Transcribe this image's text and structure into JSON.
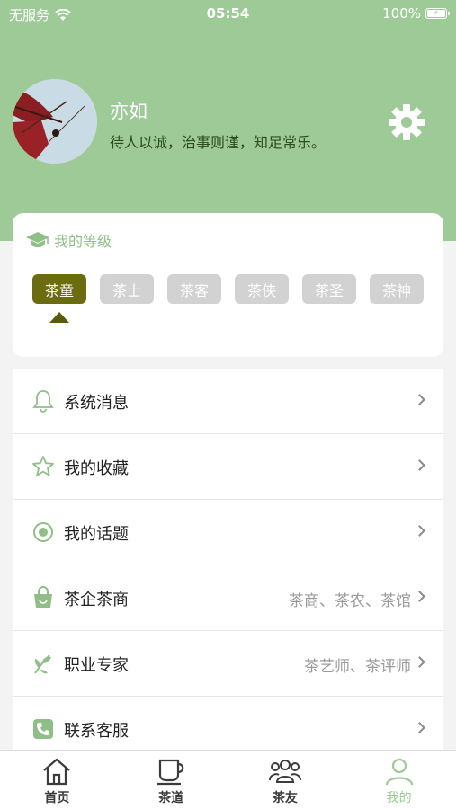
{
  "status_bar": {
    "carrier": "无服务",
    "time": "05:54",
    "battery": "100%"
  },
  "profile": {
    "name": "亦如",
    "motto": "待人以诚，治事则谨，知足常乐。"
  },
  "level": {
    "title": "我的等级",
    "levels": [
      "茶童",
      "茶士",
      "茶客",
      "茶侠",
      "茶圣",
      "茶神"
    ],
    "current": "茶童"
  },
  "menu": [
    {
      "icon": "bell-icon",
      "label": "系统消息",
      "sub": ""
    },
    {
      "icon": "star-icon",
      "label": "我的收藏",
      "sub": ""
    },
    {
      "icon": "target-icon",
      "label": "我的话题",
      "sub": ""
    },
    {
      "icon": "shopping-bag-icon",
      "label": "茶企茶商",
      "sub": "茶商、茶农、茶馆"
    },
    {
      "icon": "leaf-icon",
      "label": "职业专家",
      "sub": "茶艺师、茶评师"
    },
    {
      "icon": "phone-icon",
      "label": "联系客服",
      "sub": ""
    }
  ],
  "tabs": [
    {
      "label": "首页",
      "icon": "home-icon",
      "active": false
    },
    {
      "label": "茶道",
      "icon": "tea-cup-icon",
      "active": false
    },
    {
      "label": "茶友",
      "icon": "friends-icon",
      "active": false
    },
    {
      "label": "我的",
      "icon": "user-icon",
      "active": true
    }
  ],
  "colors": {
    "header_green": "#9dca96",
    "level_active": "#6b6b10",
    "level_inactive": "#d2d2d2",
    "accent_green": "#8fbf86"
  }
}
